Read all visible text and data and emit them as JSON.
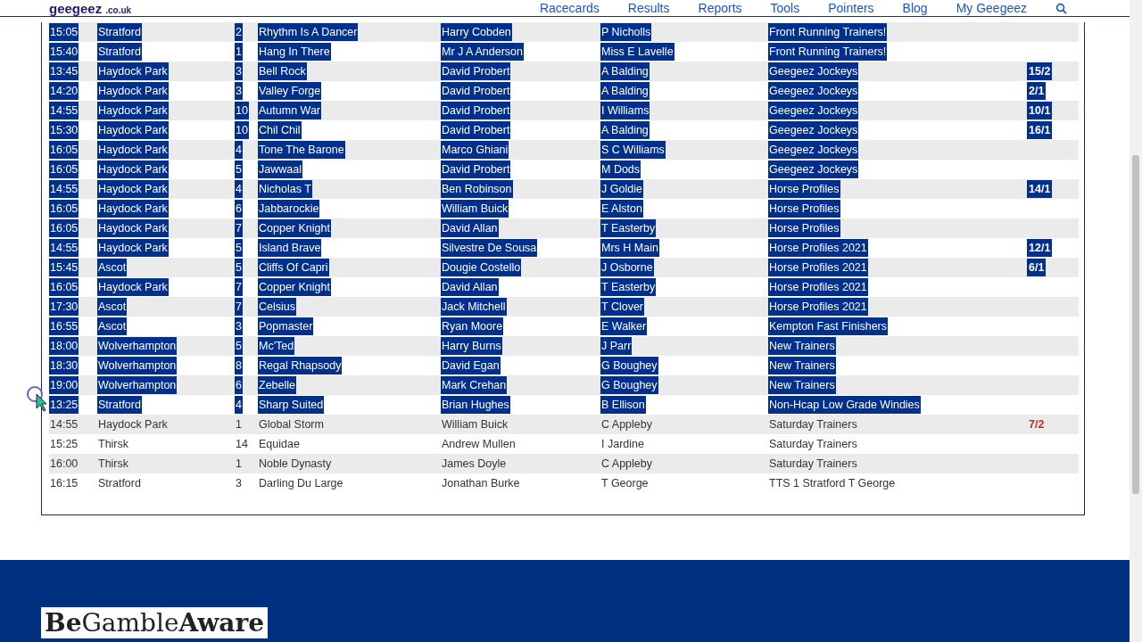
{
  "header": {
    "logo": "geegeez",
    "logo_domain": ".co.uk",
    "nav": [
      "Racecards",
      "Results",
      "Reports",
      "Tools",
      "Pointers",
      "Blog",
      "My Geegeez"
    ]
  },
  "table": {
    "rows": [
      {
        "time": "15:05",
        "course": "Stratford",
        "number": "2",
        "horse": "Rhythm Is A Dancer",
        "jockey": "Harry Cobden",
        "trainer": "P Nicholls",
        "group": "Front Running Trainers!",
        "selected": true
      },
      {
        "time": "15:40",
        "course": "Stratford",
        "number": "1",
        "horse": "Hang In There",
        "jockey": "Mr J A Anderson",
        "trainer": "Miss E Lavelle",
        "group": "Front Running Trainers!",
        "selected": true
      },
      {
        "time": "13:45",
        "course": "Haydock Park",
        "number": "3",
        "horse": "Bell Rock",
        "jockey": "David Probert",
        "trainer": "A Balding",
        "group": "Geegeez Jockeys",
        "odds": "15/2",
        "selected": true
      },
      {
        "time": "14:20",
        "course": "Haydock Park",
        "number": "3",
        "horse": "Valley Forge",
        "jockey": "David Probert",
        "trainer": "A Balding",
        "group": "Geegeez Jockeys",
        "odds": "2/1",
        "selected": true
      },
      {
        "time": "14:55",
        "course": "Haydock Park",
        "number": "10",
        "horse": "Autumn War",
        "jockey": "David Probert",
        "trainer": "I Williams",
        "group": "Geegeez Jockeys",
        "odds": "10/1",
        "selected": true
      },
      {
        "time": "15:30",
        "course": "Haydock Park",
        "number": "10",
        "horse": "Chil Chil",
        "jockey": "David Probert",
        "trainer": "A Balding",
        "group": "Geegeez Jockeys",
        "odds": "16/1",
        "selected": true
      },
      {
        "time": "16:05",
        "course": "Haydock Park",
        "number": "4",
        "horse": "Tone The Barone",
        "jockey": "Marco Ghiani",
        "trainer": "S C Williams",
        "group": "Geegeez Jockeys",
        "selected": true
      },
      {
        "time": "16:05",
        "course": "Haydock Park",
        "number": "5",
        "horse": "Jawwaal",
        "jockey": "David Probert",
        "trainer": "M Dods",
        "group": "Geegeez Jockeys",
        "selected": true
      },
      {
        "time": "14:55",
        "course": "Haydock Park",
        "number": "4",
        "horse": "Nicholas T",
        "jockey": "Ben Robinson",
        "trainer": "J Goldie",
        "group": "Horse Profiles",
        "odds": "14/1",
        "selected": true
      },
      {
        "time": "16:05",
        "course": "Haydock Park",
        "number": "6",
        "horse": "Jabbarockie",
        "jockey": "William Buick",
        "trainer": "E Alston",
        "group": "Horse Profiles",
        "selected": true
      },
      {
        "time": "16:05",
        "course": "Haydock Park",
        "number": "7",
        "horse": "Copper Knight",
        "jockey": "David Allan",
        "trainer": "T Easterby",
        "group": "Horse Profiles",
        "selected": true
      },
      {
        "time": "14:55",
        "course": "Haydock Park",
        "number": "5",
        "horse": "Island Brave",
        "jockey": "Silvestre De Sousa",
        "trainer": "Mrs H Main",
        "group": "Horse Profiles 2021",
        "odds": "12/1",
        "selected": true
      },
      {
        "time": "15:45",
        "course": "Ascot",
        "number": "5",
        "horse": "Cliffs Of Capri",
        "jockey": "Dougie Costello",
        "trainer": "J Osborne",
        "group": "Horse Profiles 2021",
        "odds": "6/1",
        "selected": true
      },
      {
        "time": "16:05",
        "course": "Haydock Park",
        "number": "7",
        "horse": "Copper Knight",
        "jockey": "David Allan",
        "trainer": "T Easterby",
        "group": "Horse Profiles 2021",
        "selected": true
      },
      {
        "time": "17:30",
        "course": "Ascot",
        "number": "7",
        "horse": "Celsius",
        "jockey": "Jack Mitchell",
        "trainer": "T Clover",
        "group": "Horse Profiles 2021",
        "selected": true
      },
      {
        "time": "16:55",
        "course": "Ascot",
        "number": "3",
        "horse": "Popmaster",
        "jockey": "Ryan Moore",
        "trainer": "E Walker",
        "group": "Kempton Fast Finishers",
        "selected": true
      },
      {
        "time": "18:00",
        "course": "Wolverhampton",
        "number": "5",
        "horse": "Mc'Ted",
        "jockey": "Harry Burns",
        "trainer": "J Parr",
        "group": "New Trainers",
        "selected": true
      },
      {
        "time": "18:30",
        "course": "Wolverhampton",
        "number": "8",
        "horse": "Regal Rhapsody",
        "jockey": "David Egan",
        "trainer": "G Boughey",
        "group": "New Trainers",
        "selected": true
      },
      {
        "time": "19:00",
        "course": "Wolverhampton",
        "number": "6",
        "horse": "Zebelle",
        "jockey": "Mark Crehan",
        "trainer": "G Boughey",
        "group": "New Trainers",
        "selected": true
      },
      {
        "time": "13:25",
        "course": "Stratford",
        "number": "4",
        "horse": "Sharp Suited",
        "jockey": "Brian Hughes",
        "trainer": "B Ellison",
        "group": "Non-Hcap Low Grade Windies",
        "selected": true
      },
      {
        "time": "14:55",
        "course": "Haydock Park",
        "number": "1",
        "horse": "Global Storm",
        "jockey": "William Buick",
        "trainer": "C Appleby",
        "group": "Saturday Trainers",
        "odds": "7/2",
        "selected": false
      },
      {
        "time": "15:25",
        "course": "Thirsk",
        "number": "14",
        "horse": "Equidae",
        "jockey": "Andrew Mullen",
        "trainer": "I Jardine",
        "group": "Saturday Trainers",
        "selected": false
      },
      {
        "time": "16:00",
        "course": "Thirsk",
        "number": "1",
        "horse": "Noble Dynasty",
        "jockey": "James Doyle",
        "trainer": "C Appleby",
        "group": "Saturday Trainers",
        "selected": false
      },
      {
        "time": "16:15",
        "course": "Stratford",
        "number": "3",
        "horse": "Darling Du Large",
        "jockey": "Jonathan Burke",
        "trainer": "T George",
        "group": "TTS 1 Stratford T George",
        "selected": false
      }
    ]
  },
  "footer": {
    "logo": "**Be**Gamble**Aware**"
  }
}
